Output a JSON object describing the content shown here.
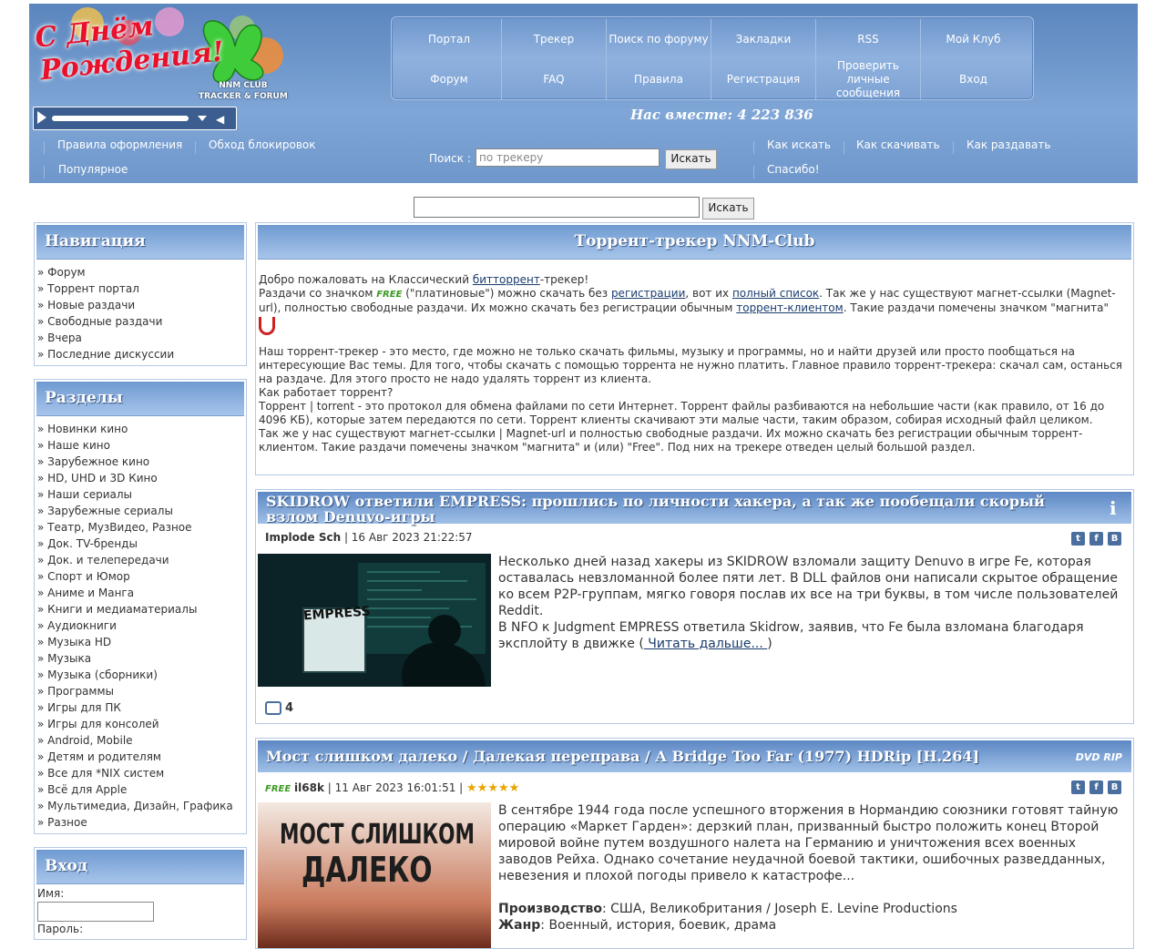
{
  "header": {
    "logo_line1": "С Днём",
    "logo_line2": "Рождения!",
    "logo_sub1": "NNM CLUB",
    "logo_sub2": "TRACKER & FORUM",
    "together": "Нас вместе: 4 223 836"
  },
  "menu": {
    "row1": [
      "Портал",
      "Трекер",
      "Поиск по форуму",
      "Закладки",
      "RSS",
      "Мой Клуб"
    ],
    "row2": [
      "Форум",
      "FAQ",
      "Правила",
      "Регистрация",
      "Проверить личные сообщения",
      "Вход"
    ]
  },
  "sublinks": {
    "left1": "Правила оформления",
    "left2": "Обход блокировок",
    "left3": "Популярное",
    "right1": "Как искать",
    "right2": "Как скачивать",
    "right3": "Как раздавать",
    "right4": "Спасибо!"
  },
  "search": {
    "label": "Поиск :",
    "placeholder": "по трекеру",
    "button": "Искать",
    "button2": "Искать"
  },
  "nav": {
    "title": "Навигация",
    "items": [
      "» Форум",
      "» Торрент портал",
      "» Новые раздачи",
      "» Свободные раздачи",
      "» Вчера",
      "» Последние дискуссии"
    ]
  },
  "sections": {
    "title": "Разделы",
    "items": [
      "» Новинки кино",
      "» Наше кино",
      "» Зарубежное кино",
      "» HD, UHD и 3D Кино",
      "» Наши сериалы",
      "» Зарубежные сериалы",
      "» Театр, МузВидео, Разное",
      "» Док. TV-бренды",
      "» Док. и телепередачи",
      "» Спорт и Юмор",
      "» Аниме и Манга",
      "» Книги и медиаматериалы",
      "» Аудиокниги",
      "» Музыка HD",
      "» Музыка",
      "» Музыка (сборники)",
      "» Программы",
      "» Игры для ПК",
      "» Игры для консолей",
      "» Android, Mobile",
      "» Детям и родителям",
      "» Все для *NIX систем",
      "» Всё для Apple",
      "» Мультимедиа, Дизайн, Графика",
      "» Разное"
    ]
  },
  "login": {
    "title": "Вход",
    "name_label": "Имя:",
    "pass_label": "Пароль:"
  },
  "main": {
    "title": "Торрент-трекер NNM-Club",
    "p1_a": "Добро пожаловать на Классический ",
    "p1_link": "битторрент",
    "p1_b": "-трекер!",
    "p2_a": "Раздачи со значком ",
    "free": "FREE",
    "p2_b": " (\"платиновые\") можно скачать без ",
    "p2_link1": "регистрации",
    "p2_c": ", вот их ",
    "p2_link2": "полный список",
    "p2_d": ". Так же у нас существуют магнет-ссылки (Magnet-url), полностью свободные раздачи. Их можно скачать без регистрации обычным ",
    "p2_link3": "торрент-клиентом",
    "p2_e": ". Такие раздачи помечены значком \"магнита\"",
    "p3": "Наш торрент-трекер - это место, где можно не только скачать фильмы, музыку и программы, но и найти друзей или просто пообщаться на интересующие Вас темы. Для того, чтобы скачать с помощью торрента не нужно платить. Главное правило торрент-трекера: скачал сам, останься на раздаче. Для этого просто не надо удалять торрент из клиента.",
    "p4": "Как работает торрент?",
    "p5": "Торрент | torrent - это протокол для обмена файлами по сети Интернет. Торрент файлы разбиваются на небольшие части (как правило, от 16 до 4096 КБ), которые затем передаются по сети. Торрент клиенты скачивают эти малые части, таким образом, собирая исходный файл целиком.",
    "p6": "Так же у нас существуют магнет-ссылки | Magnet-url и полностью свободные раздачи. Их можно скачать без регистрации обычным торрент-клиентом. Такие раздачи помечены значком \"магнита\" и (или) \"Free\". Под них на трекере отведен целый большой раздел."
  },
  "news1": {
    "title": "SKIDROW ответили EMPRESS: прошлись по личности хакера, а так же пообещали скорый взлом Denuvo-игры",
    "author": "Implode Sch",
    "date": " | 16 Авг 2023 21:22:57",
    "text": "Несколько дней назад хакеры из SKIDROW взломали защиту Denuvo в игре Fe, которая оставалась невзломанной более пяти лет. В DLL файлов они написали скрытое обращение ко всем P2P-группам, мягко говоря послав их все на три буквы, в том числе пользователей Reddit.",
    "text2": "В NFO к Judgment EMPRESS ответила Skidrow, заявив, что Fe была взломана благодаря эксплойту в движке (",
    "read_more": " Читать дальше... ",
    "text2_end": ")",
    "img_label": "EMPRESS",
    "comments": "4"
  },
  "news2": {
    "title": "Мост слишком далеко / Далекая переправа / A Bridge Too Far (1977) HDRip [H.264]",
    "badge": "DVD RIP",
    "free": "FREE",
    "author": "il68k",
    "date": " | 11 Авг 2023 16:01:51 | ",
    "stars": "★★★★★",
    "text": "В сентябре 1944 года после успешного вторжения в Нормандию союзники готовят тайную операцию «Маркет Гарден»: дерзкий план, призванный быстро положить конец Второй мировой войне путем воздушного налета на Германию и уничтожения всех военных заводов Рейха. Однако сочетание неудачной боевой тактики, ошибочных разведданных, невезения и плохой погоды привело к катастрофе...",
    "prod_label": "Производство",
    "prod": ": США, Великобритания / Joseph E. Levine Productions",
    "genre_label": "Жанр",
    "genre": ": Военный, история, боевик, драма",
    "poster_l1": "МОСТ СЛИШКОМ",
    "poster_l2": "ДАЛЕКО"
  },
  "share": {
    "t": "t",
    "f": "f",
    "b": "B"
  }
}
